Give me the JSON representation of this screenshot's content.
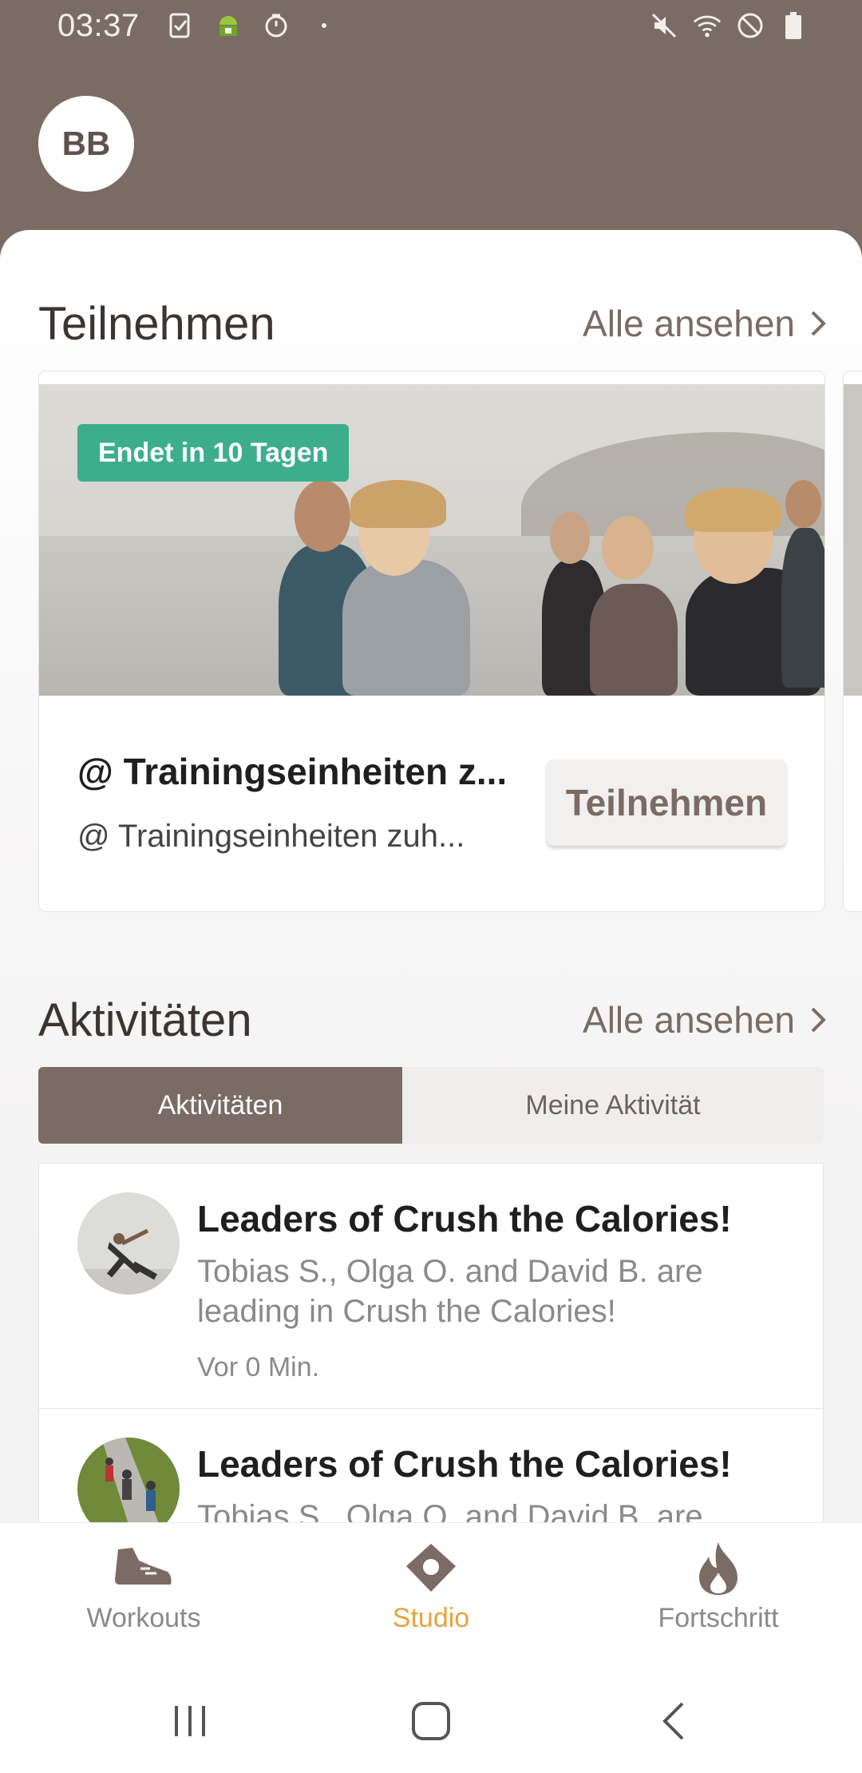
{
  "status_bar": {
    "time": "03:37"
  },
  "header": {
    "avatar_initials": "BB"
  },
  "join_section": {
    "title": "Teilnehmen",
    "see_all": "Alle ansehen",
    "card": {
      "badge": "Endet in 10 Tagen",
      "title": "@ Trainingseinheiten z...",
      "subtitle": "@ Trainingseinheiten zuh...",
      "button": "Teilnehmen"
    }
  },
  "activities_section": {
    "title": "Aktivitäten",
    "see_all": "Alle ansehen",
    "tabs": [
      {
        "label": "Aktivitäten",
        "active": true
      },
      {
        "label": "Meine Aktivität",
        "active": false
      }
    ],
    "items": [
      {
        "title": "Leaders of Crush the Calories!",
        "text": "Tobias S., Olga O. and David B. are leading in Crush the Calories!",
        "time": "Vor 0 Min."
      },
      {
        "title": "Leaders of Crush the Calories!",
        "text": "Tobias S., Olga O. and David B. are",
        "time": ""
      }
    ]
  },
  "bottom_nav": {
    "items": [
      {
        "label": "Workouts",
        "icon": "shoe-icon",
        "active": false
      },
      {
        "label": "Studio",
        "icon": "studio-diamond-icon",
        "active": true
      },
      {
        "label": "Fortschritt",
        "icon": "flame-icon",
        "active": false
      }
    ]
  },
  "colors": {
    "brand": "#7a6c64",
    "accent_active": "#e8a33d",
    "badge_green": "#3dae8b"
  }
}
